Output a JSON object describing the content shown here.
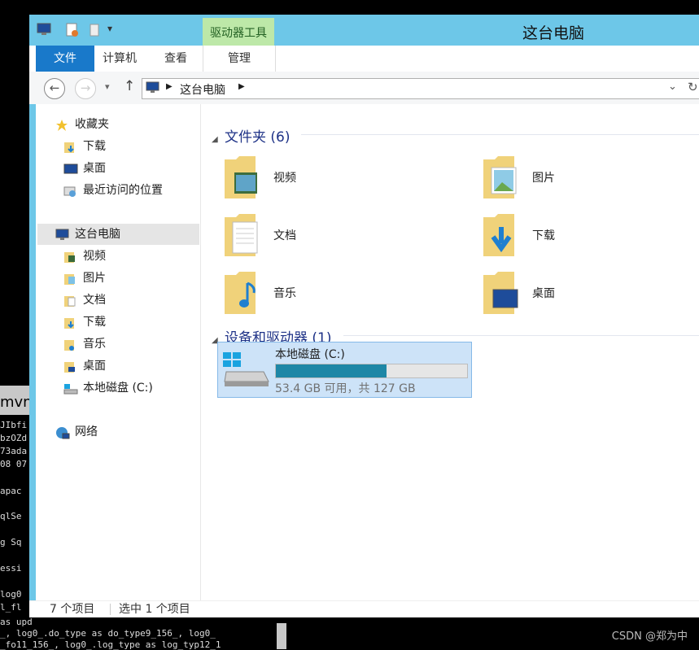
{
  "window": {
    "title": "这台电脑",
    "context_tab": "驱动器工具"
  },
  "ribbon": {
    "tabs": [
      "文件",
      "计算机",
      "查看",
      "管理"
    ]
  },
  "address": {
    "path": "这台电脑"
  },
  "sidebar": {
    "favorites": {
      "label": "收藏夹",
      "items": [
        "下载",
        "桌面",
        "最近访问的位置"
      ]
    },
    "this_pc": {
      "label": "这台电脑",
      "items": [
        "视频",
        "图片",
        "文档",
        "下载",
        "音乐",
        "桌面",
        "本地磁盘 (C:)"
      ]
    },
    "network": {
      "label": "网络"
    }
  },
  "folders": {
    "header": "文件夹 (6)",
    "items": [
      "视频",
      "图片",
      "文档",
      "下载",
      "音乐",
      "桌面"
    ]
  },
  "devices": {
    "header": "设备和驱动器 (1)",
    "drive": {
      "name": "本地磁盘 (C:)",
      "info": "53.4 GB 可用，共 127 GB",
      "used_fraction": 0.58
    }
  },
  "status": {
    "count": "7 个项目",
    "selected": "选中 1 个项目"
  },
  "terminal": {
    "label": "mvn",
    "lines": [
      "JIbfi",
      "bzOZd",
      "73ada",
      "08 07",
      "apac",
      "qlSe",
      "g Sq",
      "essi",
      "log0",
      "l_fl",
      "as upd",
      "_, log0_.do_type as do_type9_156_, log0_",
      "_fo11_156_, log0_.log_type as log_typ12_1"
    ]
  },
  "watermark": "CSDN @郑为中",
  "colors": {
    "title_bar": "#6dc7e8",
    "file_tab": "#1979ca",
    "context_tab": "#bde8a8",
    "drive_fill": "#1e87a6"
  }
}
